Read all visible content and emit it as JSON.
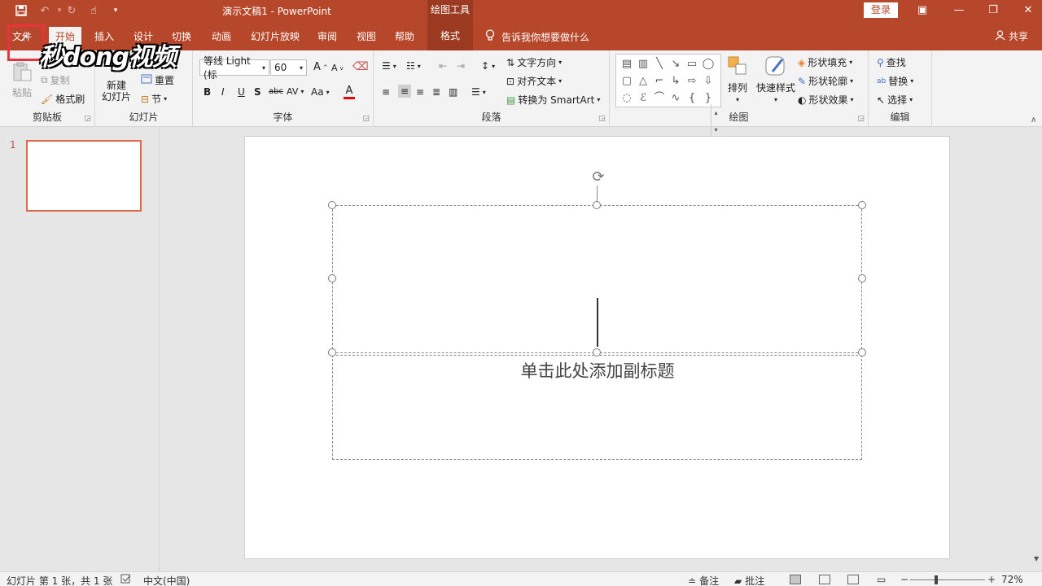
{
  "titlebar": {
    "doc_title": "演示文稿1 - PowerPoint",
    "contextual_tab_group": "绘图工具",
    "login_label": "登录",
    "quick_access": [
      "save-icon",
      "undo-icon",
      "redo-icon",
      "touch-mode-icon",
      "customize-icon"
    ]
  },
  "tabs": [
    {
      "label": "文件"
    },
    {
      "label": "开始"
    },
    {
      "label": "插入"
    },
    {
      "label": "设计"
    },
    {
      "label": "切换"
    },
    {
      "label": "动画"
    },
    {
      "label": "幻灯片放映"
    },
    {
      "label": "审阅"
    },
    {
      "label": "视图"
    },
    {
      "label": "帮助"
    },
    {
      "label": "格式"
    }
  ],
  "tellme": "告诉我你想要做什么",
  "share": "共享",
  "watermark": "秒dong视频",
  "ribbon": {
    "clipboard": {
      "paste": "粘贴",
      "copy": "复制",
      "format_painter": "格式刷",
      "label": "剪贴板"
    },
    "slides": {
      "new_slide_line1": "新建",
      "new_slide_line2": "幻灯片",
      "reset": "重置",
      "section": "节",
      "label": "幻灯片"
    },
    "font": {
      "font_name": "等线 Light (标",
      "font_size": "60",
      "bold": "B",
      "italic": "I",
      "underline": "U",
      "shadow": "S",
      "strike": "abc",
      "spacing": "AV",
      "case": "Aa",
      "color": "A",
      "grow": "A",
      "shrink": "A",
      "label": "字体"
    },
    "paragraph": {
      "text_direction": "文字方向",
      "align_text": "对齐文本",
      "smartart": "转换为 SmartArt",
      "label": "段落"
    },
    "drawing": {
      "arrange": "排列",
      "quick_styles": "快速样式",
      "fill": "形状填充",
      "outline": "形状轮廓",
      "effects": "形状效果",
      "label": "绘图"
    },
    "editing": {
      "find": "查找",
      "replace": "替换",
      "select": "选择",
      "label": "编辑"
    }
  },
  "slide_panel": {
    "slide_number": "1"
  },
  "slide": {
    "subtitle_placeholder": "单击此处添加副标题"
  },
  "status": {
    "slide_info": "幻灯片 第 1 张，共 1 张",
    "language": "中文(中国)",
    "notes": "备注",
    "comments": "批注",
    "zoom": "72%"
  },
  "colors": {
    "accent": "#b7472a",
    "contextual": "#9c3a21",
    "highlight_box": "#e8323c",
    "thumb_border": "#e0684b"
  }
}
